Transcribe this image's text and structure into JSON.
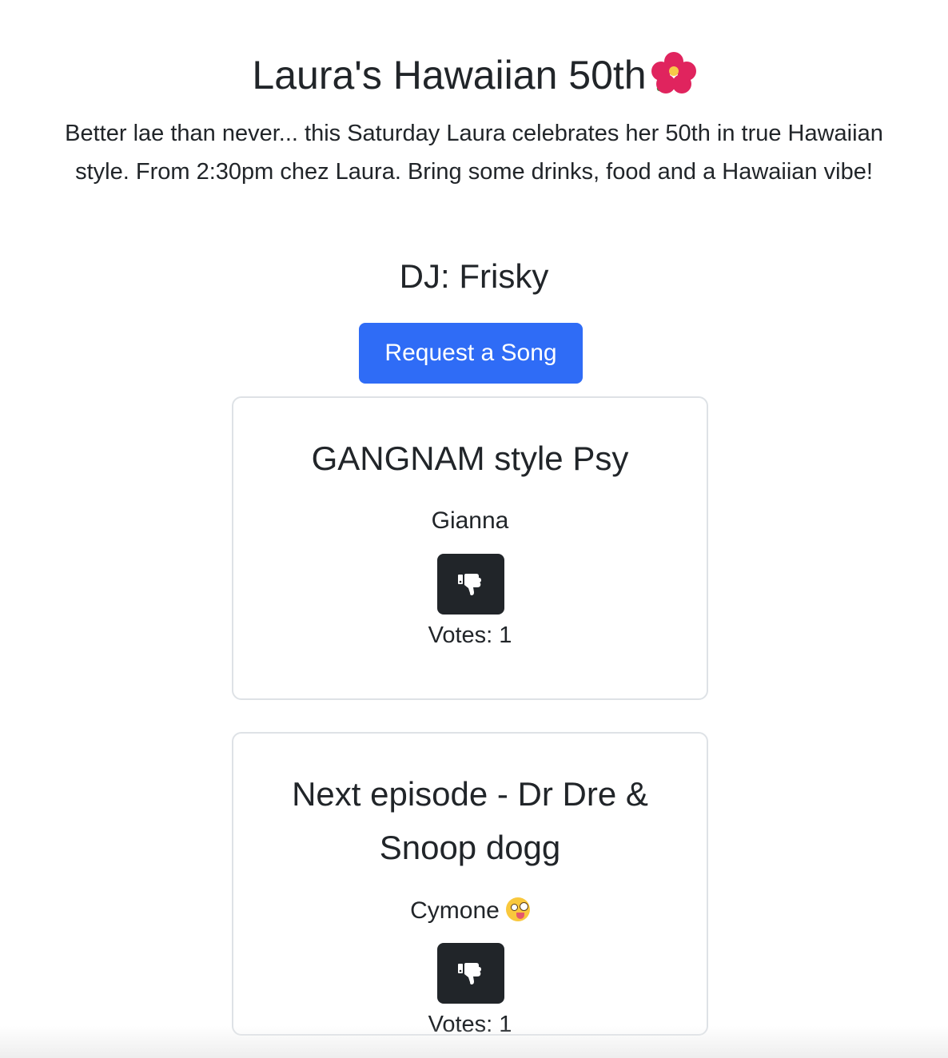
{
  "event": {
    "title": "Laura's Hawaiian 50th",
    "title_icon": "hibiscus-icon",
    "description": "Better lae than never... this Saturday Laura celebrates her 50th in true Hawaiian style. From 2:30pm chez Laura. Bring some drinks, food and a Hawaiian vibe!",
    "dj": "DJ: Frisky"
  },
  "actions": {
    "request_label": "Request a Song"
  },
  "songs": [
    {
      "title": "GANGNAM style Psy",
      "requester": "Gianna",
      "votes_label": "Votes: 1",
      "vote_icon": "thumbs-down-icon"
    },
    {
      "title": "Next episode - Dr Dre & Snoop dogg",
      "requester": "Cymone",
      "requester_icon": "zany-face-icon",
      "votes_label": "Votes: 1",
      "vote_icon": "thumbs-down-icon"
    }
  ],
  "colors": {
    "primary_button": "#2f6cf6",
    "dark_button": "#212529",
    "card_border": "#dee2e6",
    "text": "#212529"
  }
}
